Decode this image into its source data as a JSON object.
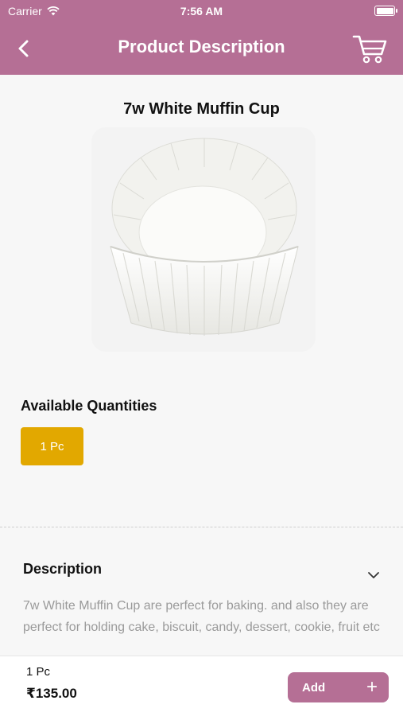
{
  "status_bar": {
    "carrier": "Carrier",
    "time": "7:56 AM"
  },
  "nav": {
    "title": "Product Description"
  },
  "product": {
    "title": "7w White Muffin Cup",
    "image_alt": "white muffin cup"
  },
  "quantities": {
    "label": "Available Quantities",
    "options": [
      "1 Pc"
    ],
    "selected": "1 Pc",
    "selected_color": "#e2a800"
  },
  "description": {
    "header": "Description",
    "text": "7w White Muffin Cup are perfect for baking. and also they are perfect for holding cake, biscuit, candy, dessert, cookie, fruit etc"
  },
  "bottom_bar": {
    "unit": "1 Pc",
    "price": "₹135.00",
    "add_label": "Add",
    "add_icon": "+"
  },
  "theme": {
    "accent": "#b56f95",
    "chip": "#e2a800"
  }
}
